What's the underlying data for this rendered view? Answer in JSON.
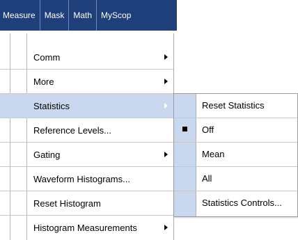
{
  "menubar": {
    "items": [
      "Measure",
      "Mask",
      "Math",
      "MyScop"
    ]
  },
  "dropdown": {
    "items": [
      {
        "label": "Comm",
        "submenu": true
      },
      {
        "label": "More",
        "submenu": true
      },
      {
        "label": "Statistics",
        "submenu": true,
        "highlighted": true
      },
      {
        "label": "Reference Levels...",
        "submenu": false
      },
      {
        "label": "Gating",
        "submenu": true
      },
      {
        "label": "Waveform Histograms...",
        "submenu": false
      },
      {
        "label": "Reset Histogram",
        "submenu": false
      },
      {
        "label": "Histogram Measurements",
        "submenu": true
      }
    ]
  },
  "statistics_submenu": {
    "items": [
      {
        "label": "Reset Statistics",
        "selected": false
      },
      {
        "label": "Off",
        "selected": true
      },
      {
        "label": "Mean",
        "selected": false
      },
      {
        "label": "All",
        "selected": false
      },
      {
        "label": "Statistics Controls...",
        "selected": false
      }
    ]
  },
  "colors": {
    "menubar_bg": "#1f3f7a",
    "highlight_bg": "#c9d8ef"
  }
}
